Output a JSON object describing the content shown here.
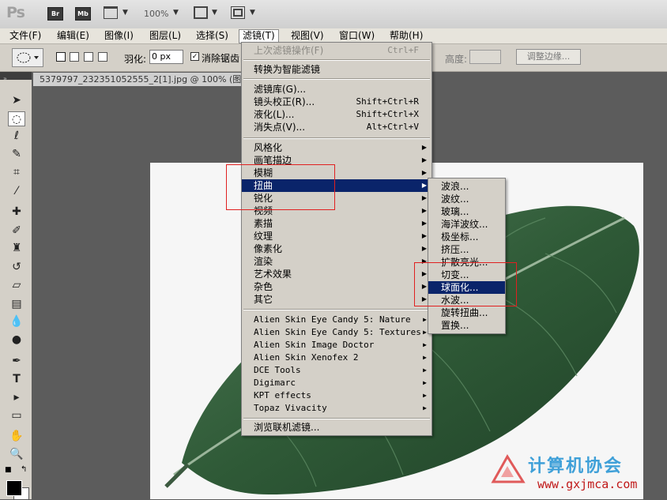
{
  "app": {
    "logo": "Ps",
    "bridge_label": "Br",
    "minibridge_label": "Mb",
    "zoom": "100%"
  },
  "menubar": [
    "文件(F)",
    "编辑(E)",
    "图像(I)",
    "图层(L)",
    "选择(S)",
    "滤镜(T)",
    "视图(V)",
    "窗口(W)",
    "帮助(H)"
  ],
  "options": {
    "feather_label": "羽化:",
    "feather_value": "0 px",
    "antialias_label": "消除锯齿",
    "height_label": "高度:",
    "refine_edge": "调整边缘..."
  },
  "document": {
    "tab_title": "5379797_232351052555_2[1].jpg @ 100% (图"
  },
  "filter_menu": {
    "last_filter": {
      "label": "上次滤镜操作(F)",
      "shortcut": "Ctrl+F"
    },
    "smart": "转换为智能滤镜",
    "group2": [
      {
        "label": "滤镜库(G)...",
        "shortcut": ""
      },
      {
        "label": "镜头校正(R)...",
        "shortcut": "Shift+Ctrl+R"
      },
      {
        "label": "液化(L)...",
        "shortcut": "Shift+Ctrl+X"
      },
      {
        "label": "消失点(V)...",
        "shortcut": "Alt+Ctrl+V"
      }
    ],
    "group3": [
      "风格化",
      "画笔描边",
      "模糊",
      "扭曲",
      "锐化",
      "视频",
      "素描",
      "纹理",
      "像素化",
      "渲染",
      "艺术效果",
      "杂色",
      "其它"
    ],
    "group4": [
      "Alien Skin Eye Candy 5: Nature",
      "Alien Skin Eye Candy 5: Textures",
      "Alien Skin Image Doctor",
      "Alien Skin Xenofex 2",
      "DCE Tools",
      "Digimarc",
      "KPT effects",
      "Topaz Vivacity"
    ],
    "browse": "浏览联机滤镜..."
  },
  "distort_menu": [
    "波浪...",
    "波纹...",
    "玻璃...",
    "海洋波纹...",
    "极坐标...",
    "挤压...",
    "扩散亮光...",
    "切变...",
    "球面化...",
    "水波...",
    "旋转扭曲...",
    "置换..."
  ],
  "watermark": {
    "text": "计算机协会",
    "url": "www.gxjmca.com"
  },
  "colors": {
    "highlight": "#0a246a",
    "annotation": "#e02020",
    "leaf": "#2f5a37"
  }
}
